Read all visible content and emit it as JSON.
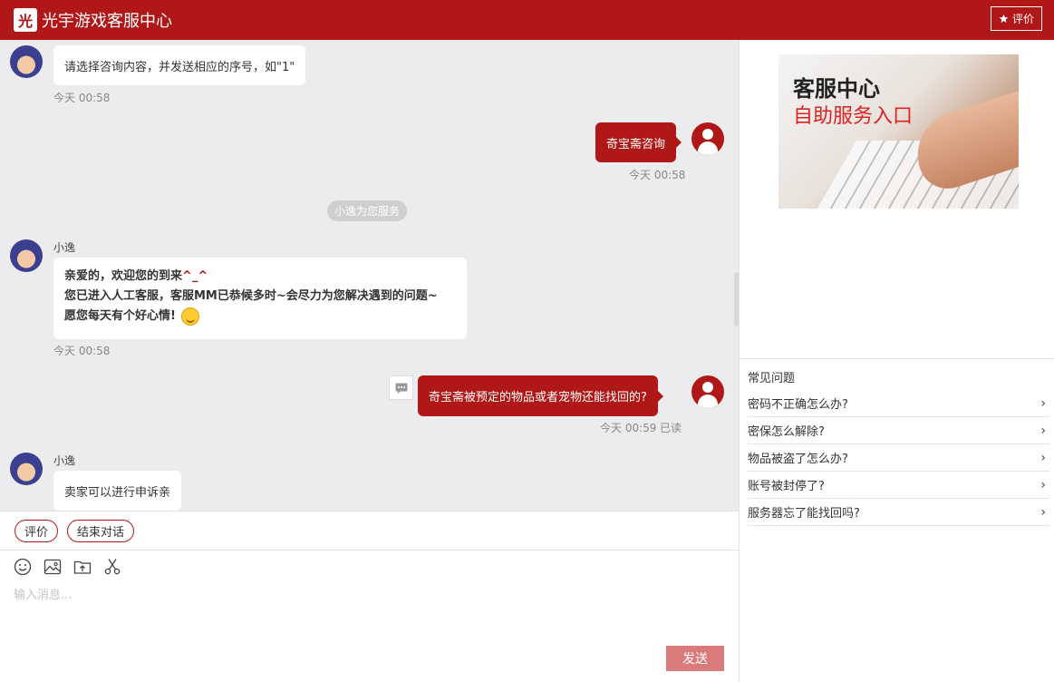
{
  "header": {
    "logo_text": "光",
    "title": "光宇游戏客服中心",
    "rate_label": "评价"
  },
  "chat": {
    "messages": [
      {
        "text": "请选择咨询内容，并发送相应的序号，如\"1\"",
        "time": "今天 00:58"
      },
      {
        "text": "奇宝斋咨询",
        "time": "今天 00:58"
      },
      {
        "system": "小逸为您服务"
      },
      {
        "name": "小逸",
        "line1_a": "亲爱的，欢迎您的到来",
        "line1_b": "^_^",
        "line2": "您已进入人工客服，客服MM已恭候多时~会尽力为您解决遇到的问题~",
        "line3": "愿您每天有个好心情!",
        "time": "今天 00:58"
      },
      {
        "text": "奇宝斋被预定的物品或者宠物还能找回的?",
        "time": "今天 00:59",
        "status": "已读"
      },
      {
        "name": "小逸",
        "text": "卖家可以进行申诉亲"
      }
    ]
  },
  "actions": {
    "rate_label": "评价",
    "end_label": "结束对话"
  },
  "composer": {
    "tools": [
      "emoji-icon",
      "image-icon",
      "folder-upload-icon",
      "scissors-icon"
    ],
    "placeholder": "输入消息...",
    "send_label": "发送"
  },
  "sidebar": {
    "banner_title": "客服中心",
    "banner_subtitle": "自助服务入口",
    "faq_title": "常见问题",
    "faq": [
      "密码不正确怎么办?",
      "密保怎么解除?",
      "物品被盗了怎么办?",
      "账号被封停了?",
      "服务器忘了能找回吗?"
    ]
  },
  "colors": {
    "brand": "#b01818",
    "send_disabled": "#d97b7b",
    "chat_bg": "#ececee"
  }
}
